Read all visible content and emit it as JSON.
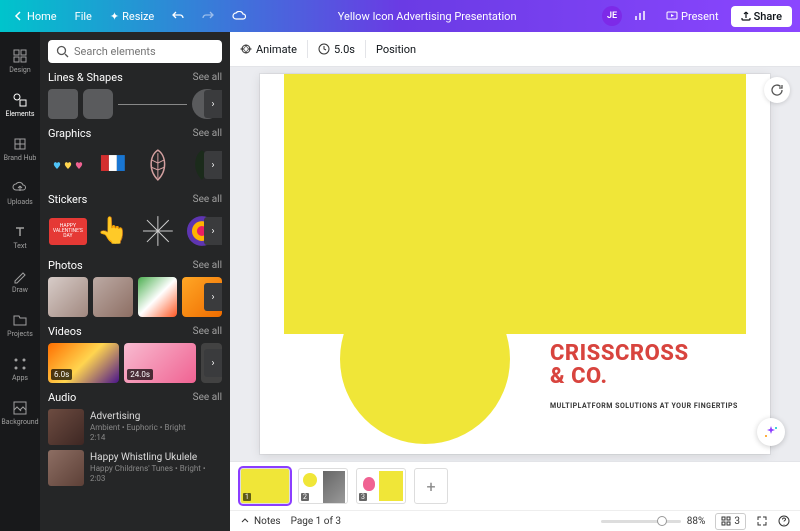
{
  "topbar": {
    "home": "Home",
    "file": "File",
    "resize": "Resize",
    "title": "Yellow Icon Advertising Presentation",
    "avatar": "JE",
    "present": "Present",
    "share": "Share"
  },
  "rail": [
    {
      "label": "Design",
      "icon": "design"
    },
    {
      "label": "Elements",
      "icon": "elements"
    },
    {
      "label": "Brand Hub",
      "icon": "brand"
    },
    {
      "label": "Uploads",
      "icon": "uploads"
    },
    {
      "label": "Text",
      "icon": "text"
    },
    {
      "label": "Draw",
      "icon": "draw"
    },
    {
      "label": "Projects",
      "icon": "projects"
    },
    {
      "label": "Apps",
      "icon": "apps"
    },
    {
      "label": "Background",
      "icon": "background"
    }
  ],
  "search": {
    "placeholder": "Search elements"
  },
  "sections": {
    "shapes": {
      "title": "Lines & Shapes",
      "see": "See all"
    },
    "graphics": {
      "title": "Graphics",
      "see": "See all"
    },
    "stickers": {
      "title": "Stickers",
      "see": "See all"
    },
    "photos": {
      "title": "Photos",
      "see": "See all"
    },
    "videos": {
      "title": "Videos",
      "see": "See all",
      "dur1": "6.0s",
      "dur2": "24.0s"
    },
    "audio": {
      "title": "Audio",
      "see": "See all",
      "items": [
        {
          "title": "Advertising",
          "sub": "Ambient • Euphoric • Bright",
          "dur": "2:14"
        },
        {
          "title": "Happy Whistling Ukulele",
          "sub": "Happy Childrens' Tunes • Bright •",
          "dur": "2:03"
        }
      ]
    }
  },
  "context": {
    "animate": "Animate",
    "timer": "5.0s",
    "position": "Position"
  },
  "slide": {
    "title1": "CRISSCROSS",
    "title2": "& CO.",
    "sub": "MULTIPLATFORM SOLUTIONS AT YOUR FINGERTIPS"
  },
  "status": {
    "notes": "Notes",
    "page": "Page 1 of 3",
    "zoom": "88%",
    "pagecount": "3"
  }
}
